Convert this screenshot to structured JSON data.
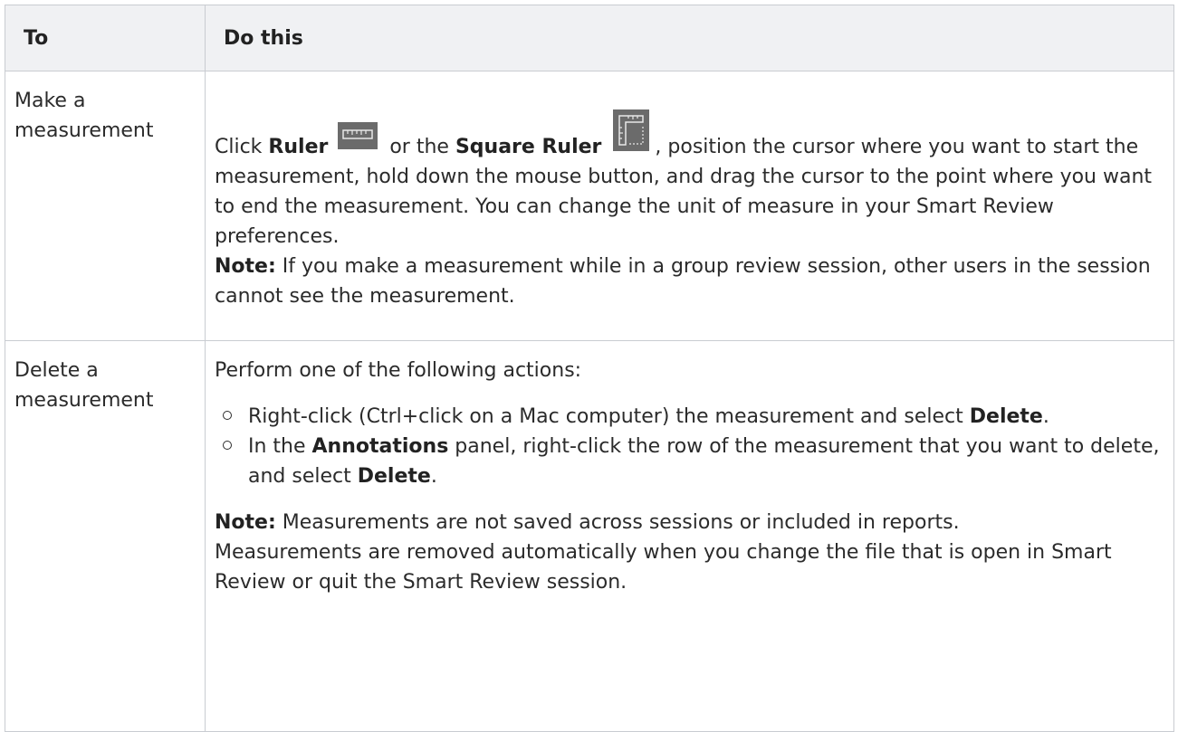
{
  "header": {
    "col1": "To",
    "col2": "Do this"
  },
  "rows": [
    {
      "task": "Make a measurement",
      "click_word": "Click",
      "ruler_label": "Ruler",
      "or_the": "or the",
      "square_ruler_label": "Square Ruler",
      "instruction_rest": ", position the cursor where you want to start the measurement, hold down the mouse button, and drag the cursor to the point where you want to end the measurement. You can change the unit of measure in your Smart Review preferences.",
      "note_label": "Note:",
      "note_text": "If you make a measurement while in a group review session, other users in the session cannot see the measurement.",
      "icons": [
        "ruler-icon",
        "square-ruler-icon"
      ]
    },
    {
      "task": "Delete a measurement",
      "intro": "Perform one of the following actions:",
      "bullets": [
        {
          "text": "Right-click (Ctrl+click on a Mac computer) the measurement and select",
          "bold": "Delete",
          "end": "."
        },
        {
          "pre": "In the",
          "bold_panel": "Annotations",
          "text": "panel, right-click the row of the measurement that you want to delete, and select",
          "bold": "Delete",
          "end": "."
        }
      ],
      "note_label": "Note:",
      "note_text": "Measurements are not saved across sessions or included in reports.",
      "final_text": "Measurements are removed automatically when you change the file that is open in Smart Review or quit the Smart Review session."
    }
  ],
  "colors": {
    "header_bg": "#f0f1f3",
    "border": "#c9ccd1",
    "icon_bg": "#6b6b6b"
  }
}
